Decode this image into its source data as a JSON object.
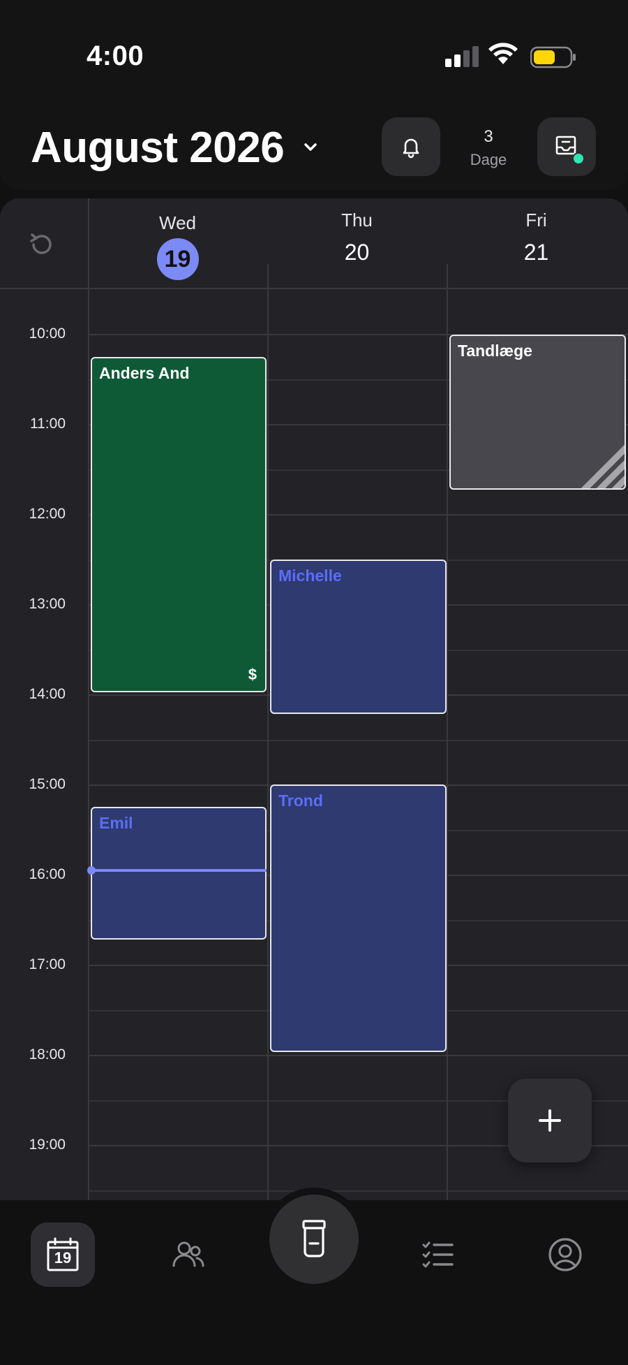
{
  "status_bar": {
    "time": "4:00"
  },
  "header": {
    "month_title": "August 2026",
    "days_count": "3",
    "days_label": "Dage"
  },
  "calendar": {
    "days": [
      {
        "name": "Wed",
        "number": "19",
        "today": true
      },
      {
        "name": "Thu",
        "number": "20",
        "today": false
      },
      {
        "name": "Fri",
        "number": "21",
        "today": false
      }
    ],
    "hours": [
      "10:00",
      "11:00",
      "12:00",
      "13:00",
      "14:00",
      "15:00",
      "16:00",
      "17:00",
      "18:00",
      "19:00"
    ],
    "events": [
      {
        "title": "Anders And",
        "day": "Wed",
        "start": "10:15",
        "end": "14:00",
        "color": "#0f5a36",
        "badge": "$"
      },
      {
        "title": "Michelle",
        "day": "Thu",
        "start": "12:30",
        "end": "14:15",
        "color": "#2e3a70"
      },
      {
        "title": "Emil",
        "day": "Wed",
        "start": "15:15",
        "end": "16:45",
        "color": "#2e3a70"
      },
      {
        "title": "Trond",
        "day": "Thu",
        "start": "15:00",
        "end": "18:00",
        "color": "#2e3a70"
      },
      {
        "title": "Tandlæge",
        "day": "Fri",
        "start": "10:00",
        "end": "11:45",
        "color": "#47474d"
      }
    ],
    "current_time_indicator": "16:00"
  },
  "tabbar": {
    "calendar_day": "19",
    "items": [
      "calendar-icon",
      "people-icon",
      "cup-icon",
      "checklist-icon",
      "profile-icon"
    ]
  },
  "colors": {
    "accent": "#7b8af5",
    "event_blue": "#2e3a70",
    "event_green": "#0f5a36",
    "event_gray": "#47474d",
    "badge_dot": "#2ee6b4"
  }
}
